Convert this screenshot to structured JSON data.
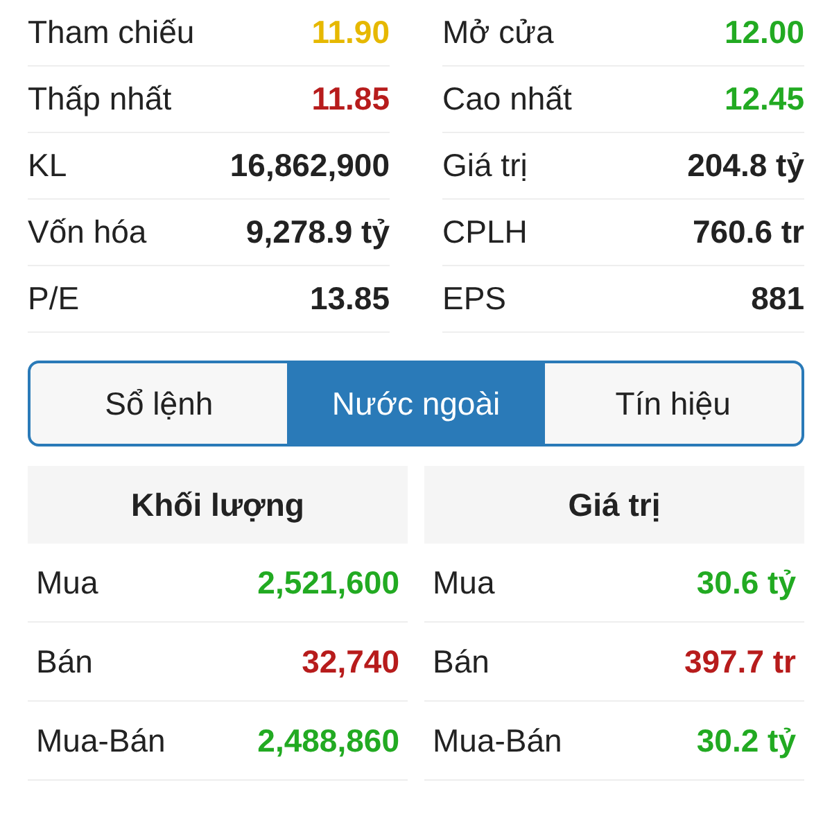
{
  "stats": [
    {
      "label": "Tham chiếu",
      "value": "11.90",
      "color": "#e6b800"
    },
    {
      "label": "Mở cửa",
      "value": "12.00",
      "color": "#22aa22"
    },
    {
      "label": "Thấp nhất",
      "value": "11.85",
      "color": "#b71c1c"
    },
    {
      "label": "Cao nhất",
      "value": "12.45",
      "color": "#22aa22"
    },
    {
      "label": "KL",
      "value": "16,862,900",
      "color": "#222222"
    },
    {
      "label": "Giá trị",
      "value": "204.8 tỷ",
      "color": "#222222"
    },
    {
      "label": "Vốn hóa",
      "value": "9,278.9 tỷ",
      "color": "#222222"
    },
    {
      "label": "CPLH",
      "value": "760.6 tr",
      "color": "#222222"
    },
    {
      "label": "P/E",
      "value": "13.85",
      "color": "#222222"
    },
    {
      "label": "EPS",
      "value": "881",
      "color": "#222222"
    }
  ],
  "tabs": [
    {
      "label": "Sổ lệnh",
      "selected": false
    },
    {
      "label": "Nước ngoài",
      "selected": true
    },
    {
      "label": "Tín hiệu",
      "selected": false
    }
  ],
  "foreign": [
    {
      "title": "Khối lượng",
      "rows": [
        {
          "label": "Mua",
          "value": "2,521,600",
          "color": "#22aa22"
        },
        {
          "label": "Bán",
          "value": "32,740",
          "color": "#b71c1c"
        },
        {
          "label": "Mua-Bán",
          "value": "2,488,860",
          "color": "#22aa22"
        }
      ]
    },
    {
      "title": "Giá trị",
      "rows": [
        {
          "label": "Mua",
          "value": "30.6 tỷ",
          "color": "#22aa22"
        },
        {
          "label": "Bán",
          "value": "397.7 tr",
          "color": "#b71c1c"
        },
        {
          "label": "Mua-Bán",
          "value": "30.2 tỷ",
          "color": "#22aa22"
        }
      ]
    }
  ]
}
